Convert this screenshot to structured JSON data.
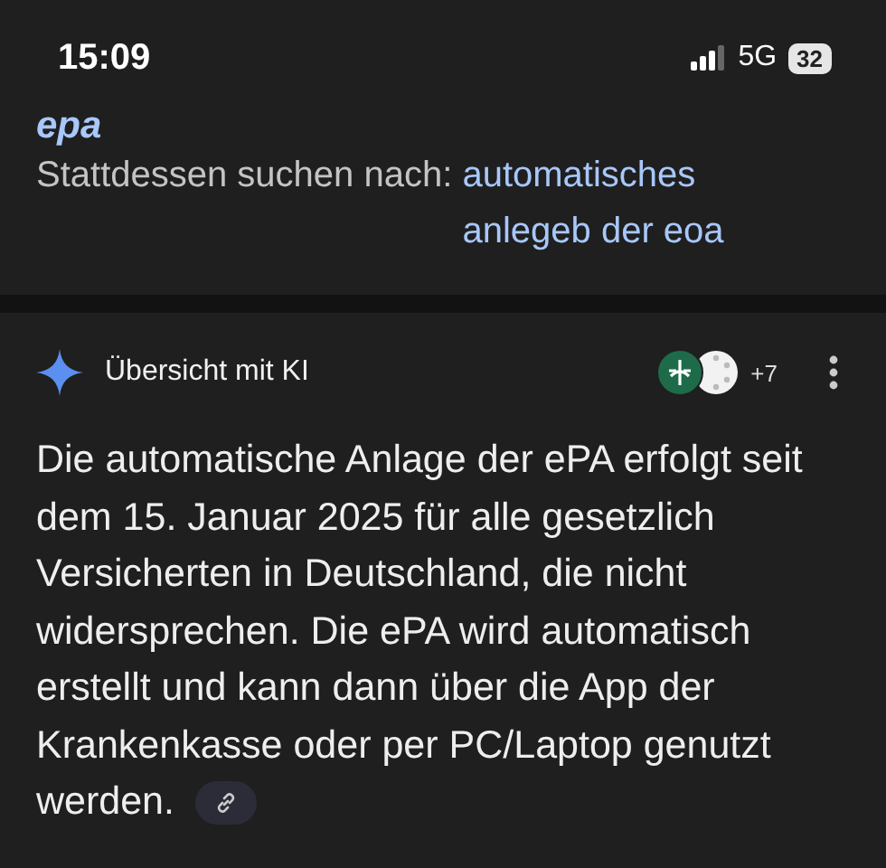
{
  "status_bar": {
    "time": "15:09",
    "network": "5G",
    "battery": "32"
  },
  "search_correction": {
    "query": "epa",
    "prefix": "Stattdessen suchen nach:",
    "suggestion": "automatisches anlegeb der eoa"
  },
  "ai_overview": {
    "title": "Übersicht mit KI",
    "sources_count": "+7",
    "text": "Die automatische Anlage der ePA erfolgt seit dem 15. Januar 2025 für alle gesetzlich Versicherten in Deutschland, die nicht widersprechen. Die ePA wird automatisch erstellt und kann dann über die App der Krankenkasse oder per PC/Laptop genutzt werden."
  }
}
